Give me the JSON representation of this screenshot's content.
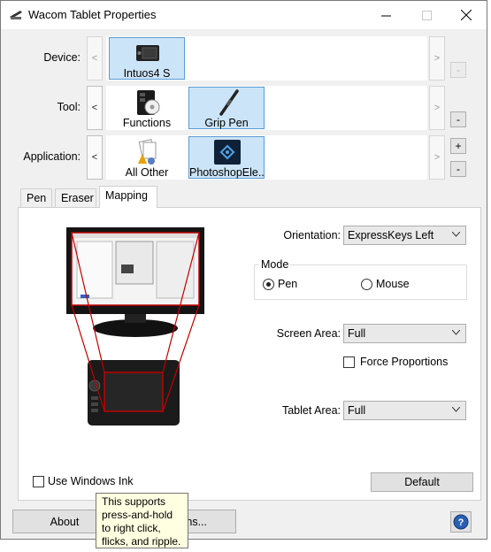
{
  "window": {
    "title": "Wacom Tablet Properties",
    "accent": "#cce4f7"
  },
  "device_row": {
    "label": "Device:",
    "scroll_left": "<",
    "scroll_right": ">",
    "remove": "-",
    "items": [
      {
        "label": "Intuos4 S",
        "icon": "tablet-icon",
        "selected": true
      }
    ]
  },
  "tool_row": {
    "label": "Tool:",
    "scroll_left": "<",
    "scroll_right": ">",
    "remove": "-",
    "items": [
      {
        "label": "Functions",
        "icon": "functions-icon",
        "selected": false
      },
      {
        "label": "Grip Pen",
        "icon": "pen-icon",
        "selected": true
      }
    ]
  },
  "application_row": {
    "label": "Application:",
    "scroll_left": "<",
    "scroll_right": ">",
    "add": "+",
    "remove": "-",
    "items": [
      {
        "label": "All Other",
        "icon": "all-other-icon",
        "selected": false
      },
      {
        "label": "PhotoshopEle...",
        "icon": "photoshop-elements-icon",
        "selected": true
      }
    ]
  },
  "tabs": [
    {
      "label": "Pen",
      "active": false
    },
    {
      "label": "Eraser",
      "active": false
    },
    {
      "label": "Mapping",
      "active": true
    }
  ],
  "mapping": {
    "orientation_label": "Orientation:",
    "orientation_value": "ExpressKeys Left",
    "mode_title": "Mode",
    "mode_pen": "Pen",
    "mode_mouse": "Mouse",
    "mode_selected": "Pen",
    "screen_area_label": "Screen Area:",
    "screen_area_value": "Full",
    "force_proportions": "Force Proportions",
    "force_proportions_checked": false,
    "tablet_area_label": "Tablet Area:",
    "tablet_area_value": "Full",
    "use_windows_ink": "Use Windows Ink",
    "use_windows_ink_checked": false,
    "default_button": "Default",
    "mapping_line_color": "#c00000"
  },
  "tooltip": {
    "text": "This supports press-and-hold to right click, flicks, and ripple."
  },
  "footer": {
    "about_button": "About",
    "options_button_visible_text": "ns..."
  }
}
